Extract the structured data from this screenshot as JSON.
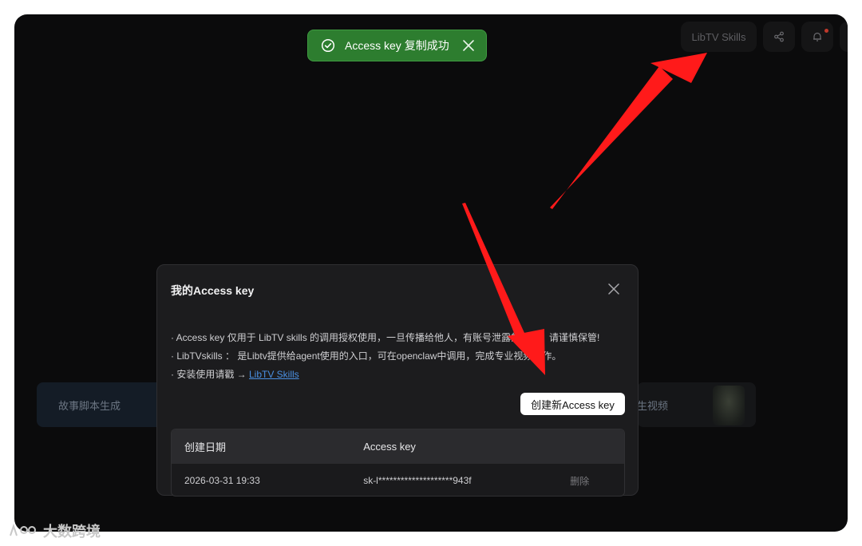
{
  "header": {
    "skills_label": "LibTV Skills"
  },
  "toast": {
    "message": "Access key 复制成功",
    "color": "#2d7d2f"
  },
  "background": {
    "card_left_label": "故事脚本生成",
    "card_right_label": "生视频"
  },
  "modal": {
    "title": "我的Access key",
    "note1": "· Access key 仅用于 LibTV skills 的调用授权使用，一旦传播给他人，有账号泄露的风险，请谨慎保管!",
    "note2": "· LibTVskills ： 是Libtv提供给agent使用的入口，可在openclaw中调用，完成专业视频创作。",
    "note3_prefix": "· 安装使用请戳 → ",
    "note3_link": "LibTV Skills",
    "create_button": "创建新Access key",
    "table": {
      "headers": [
        "创建日期",
        "Access key",
        ""
      ],
      "rows": [
        {
          "date": "2026-03-31 19:33",
          "key": "sk-l********************943f",
          "action": "删除"
        }
      ]
    }
  },
  "watermark": {
    "text": "大数跨境"
  },
  "colors": {
    "accent_link": "#4a90e2",
    "annotation_arrow": "#ff0000"
  }
}
